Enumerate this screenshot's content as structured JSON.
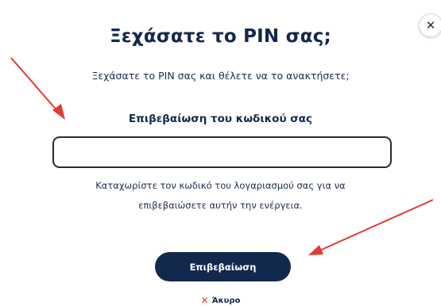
{
  "dialog": {
    "title": "Ξεχάσατε το PIN σας;",
    "subtitle": "Ξεχάσατε το PIN σας και θέλετε να το ανακτήσετε;",
    "field_label": "Επιβεβαίωση του κωδικού σας",
    "code_value": "",
    "helper_line1": "Καταχωρίστε τον κωδικό του λογαριασμού σας για να",
    "helper_line2": "επιβεβαιώσετε αυτήν την ενέργεια.",
    "confirm_label": "Επιβεβαίωση",
    "cancel_label": "Άκυρο"
  },
  "icons": {
    "close": "close-icon",
    "cancel": "cross-icon",
    "annotations": "red-arrow-icon"
  },
  "colors": {
    "primary": "#13284d",
    "accent_red": "#e53935",
    "input_border": "#2a2a2a"
  }
}
